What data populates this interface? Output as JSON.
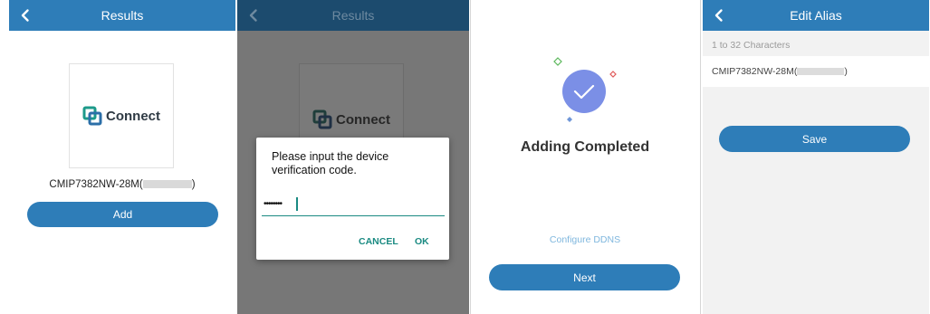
{
  "colors": {
    "primary": "#2e7db8",
    "primary_dim": "#1c4b6e",
    "overlay_page": "#777777",
    "dialog_accent": "#1a8a82",
    "check_circle": "#7b8fe6"
  },
  "panel1": {
    "title": "Results",
    "logo_text": "Connect",
    "device_name": "CMIP7382NW-28M(",
    "device_name_suffix": ")",
    "add_label": "Add"
  },
  "panel2": {
    "title": "Results",
    "logo_text": "Connect",
    "dialog": {
      "message": "Please input the device verification code.",
      "input_value": "••••••••",
      "cancel_label": "CANCEL",
      "ok_label": "OK"
    }
  },
  "panel3": {
    "heading": "Adding Completed",
    "configure_link": "Configure DDNS",
    "next_label": "Next"
  },
  "panel4": {
    "title": "Edit Alias",
    "hint": "1 to 32 Characters",
    "alias_value": "CMIP7382NW-28M(",
    "alias_suffix": ")",
    "save_label": "Save"
  }
}
